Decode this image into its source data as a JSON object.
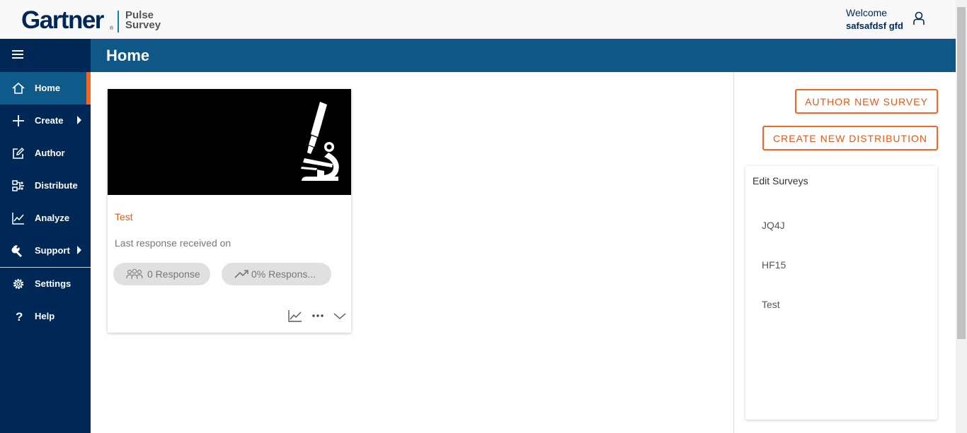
{
  "header": {
    "brand": "Gartner",
    "brand_reg": "®",
    "product_line1": "Pulse",
    "product_line2": "Survey",
    "welcome": "Welcome",
    "username": "safsafdsf gfd"
  },
  "sidebar": {
    "items": [
      {
        "label": "Home",
        "icon": "home-icon",
        "active": true
      },
      {
        "label": "Create",
        "icon": "plus-icon",
        "submenu": true
      },
      {
        "label": "Author",
        "icon": "edit-icon"
      },
      {
        "label": "Distribute",
        "icon": "distribute-icon"
      },
      {
        "label": "Analyze",
        "icon": "chart-line-icon"
      },
      {
        "label": "Support",
        "icon": "wrench-icon",
        "submenu": true
      },
      {
        "label": "Settings",
        "icon": "gear-icon"
      },
      {
        "label": "Help",
        "icon": "question-icon"
      }
    ]
  },
  "page": {
    "title": "Home"
  },
  "card": {
    "title": "Test",
    "subtitle": "Last response received on",
    "responses": "0 Response",
    "response_rate": "0% Respons..."
  },
  "actions": {
    "author_new_survey": "AUTHOR NEW SURVEY",
    "create_new_distribution": "CREATE NEW DISTRIBUTION"
  },
  "edit_surveys": {
    "title": "Edit Surveys",
    "items": [
      "JQ4J",
      "HF15",
      "Test"
    ]
  },
  "colors": {
    "sidebar_bg": "#002856",
    "titlebar_bg": "#0f5787",
    "accent": "#f26522",
    "active_item_bg": "#0e5a8a"
  }
}
